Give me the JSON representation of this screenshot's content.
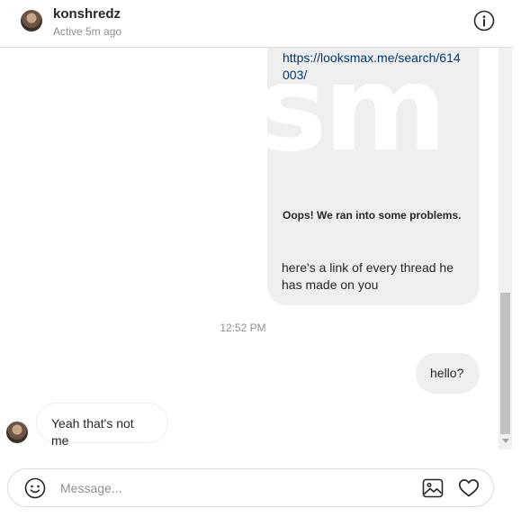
{
  "header": {
    "name": "konshredz",
    "status": "Active 5m ago",
    "info_icon": "info-icon"
  },
  "thread": {
    "link_card": {
      "url": "https://looksmax.me/search/614003/",
      "preview_text": "sm",
      "error": "Oops! We ran into some problems."
    },
    "messages": [
      {
        "text": "here's a link of every thread he has made on you",
        "direction": "sent"
      },
      {
        "text": "hello?",
        "direction": "sent"
      },
      {
        "text": "Yeah that's not me",
        "direction": "received"
      }
    ],
    "timestamp": "12:52 PM"
  },
  "composer": {
    "placeholder": "Message...",
    "emoji_icon": "emoji-icon",
    "image_icon": "image-icon",
    "heart_icon": "heart-icon"
  },
  "colors": {
    "bubble": "#efefef",
    "link": "#00376b",
    "muted": "#8e8e8e",
    "border": "#dbdbdb"
  }
}
